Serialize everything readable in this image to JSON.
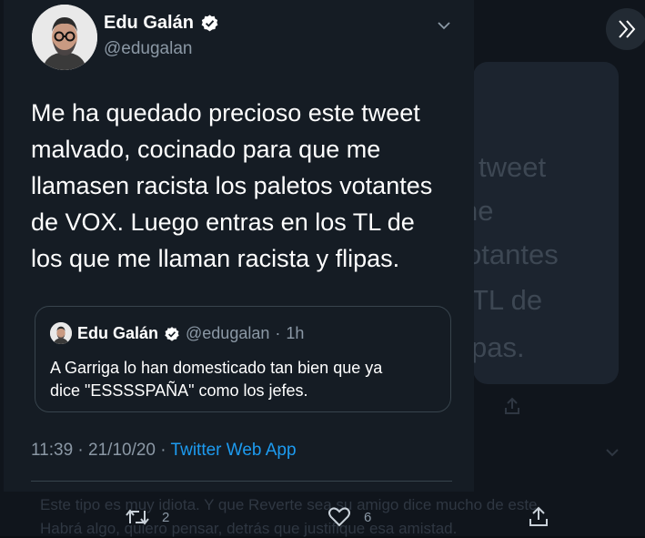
{
  "tweet": {
    "author": {
      "name": "Edu Galán",
      "handle": "@edugalan",
      "verified": true
    },
    "text_lines": [
      "Me ha quedado precioso este tweet",
      "malvado, cocinado para que me",
      "llamasen racista los paletos votantes",
      "de VOX. Luego entras en los TL de",
      "los que me llaman racista y flipas."
    ],
    "quote": {
      "name": "Edu Galán",
      "handle": "@edugalan",
      "separator": "·",
      "time": "1h",
      "text_lines": [
        "A Garriga lo han domesticado tan bien que ya",
        "dice \"ESSSSPAÑA\" como los jefes."
      ]
    },
    "time": "11:39",
    "separator": "·",
    "date": "21/10/20",
    "source": "Twitter Web App"
  },
  "background": {
    "ghost_lines": [
      "tweet",
      "ne",
      "otantes",
      "TL de",
      "pas."
    ],
    "reply_lines": [
      "Este tipo es muy idiota. Y que Reverte sea su amigo dice mucho de este.",
      "Habrá algo, quiero pensar, detrás que justifique esa amistad."
    ],
    "retweets": "2",
    "likes": "6"
  },
  "colors": {
    "accent": "#1d9bf0",
    "card": "#151c24",
    "muted": "#8b98a5"
  },
  "icons": {
    "verified": "verified-badge-icon",
    "menu": "chevron-down-icon",
    "next": "double-chevron-right-icon",
    "retweet": "retweet-icon",
    "like": "heart-icon",
    "share": "share-icon"
  }
}
